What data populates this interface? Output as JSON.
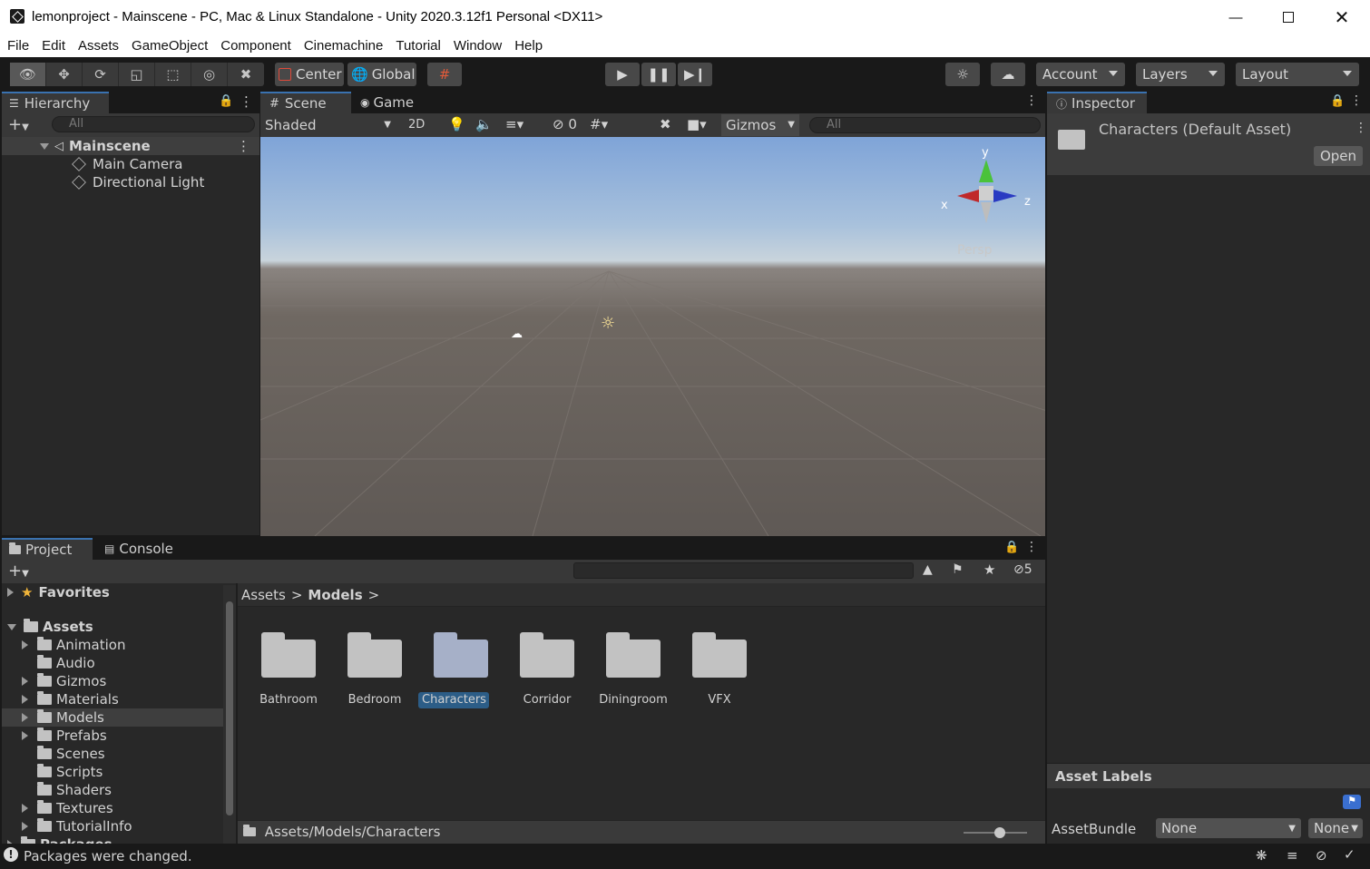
{
  "window": {
    "title": "lemonproject - Mainscene - PC, Mac & Linux Standalone - Unity 2020.3.12f1 Personal <DX11>"
  },
  "menu": [
    "File",
    "Edit",
    "Assets",
    "GameObject",
    "Component",
    "Cinemachine",
    "Tutorial",
    "Window",
    "Help"
  ],
  "toolbar": {
    "pivot": "Center",
    "space": "Global",
    "account": "Account",
    "layers": "Layers",
    "layout": "Layout"
  },
  "hierarchy": {
    "tab": "Hierarchy",
    "search_placeholder": "All",
    "scene": "Mainscene",
    "objects": [
      "Main Camera",
      "Directional Light"
    ]
  },
  "scene": {
    "tabs": [
      "Scene",
      "Game"
    ],
    "shading": "Shaded",
    "mode_2d": "2D",
    "hidden_count": "0",
    "gizmos": "Gizmos",
    "search_placeholder": "All",
    "axes": {
      "x": "x",
      "y": "y",
      "z": "z"
    },
    "projection": "Persp"
  },
  "inspector": {
    "tab": "Inspector",
    "asset_title": "Characters (Default Asset)",
    "open_button": "Open",
    "asset_labels": "Asset Labels",
    "assetbundle_label": "AssetBundle",
    "assetbundle_value": "None",
    "variant_value": "None"
  },
  "project": {
    "tabs": [
      "Project",
      "Console"
    ],
    "hidden_count": "5",
    "favorites": "Favorites",
    "assets_root": "Assets",
    "tree": [
      {
        "label": "Animation",
        "expandable": true
      },
      {
        "label": "Audio",
        "expandable": false
      },
      {
        "label": "Gizmos",
        "expandable": true
      },
      {
        "label": "Materials",
        "expandable": true
      },
      {
        "label": "Models",
        "expandable": true,
        "selected": true
      },
      {
        "label": "Prefabs",
        "expandable": true
      },
      {
        "label": "Scenes",
        "expandable": false
      },
      {
        "label": "Scripts",
        "expandable": false
      },
      {
        "label": "Shaders",
        "expandable": false
      },
      {
        "label": "Textures",
        "expandable": true
      },
      {
        "label": "TutorialInfo",
        "expandable": true
      }
    ],
    "packages": "Packages",
    "breadcrumb": [
      "Assets",
      "Models"
    ],
    "folders": [
      "Bathroom",
      "Bedroom",
      "Characters",
      "Corridor",
      "Diningroom",
      "VFX"
    ],
    "selected_folder": "Characters",
    "path": "Assets/Models/Characters"
  },
  "status": {
    "message": "Packages were changed."
  },
  "colors": {
    "accent": "#3a72b0",
    "selection": "#2c5d87",
    "panel": "#282828",
    "toolbar": "#191919"
  }
}
